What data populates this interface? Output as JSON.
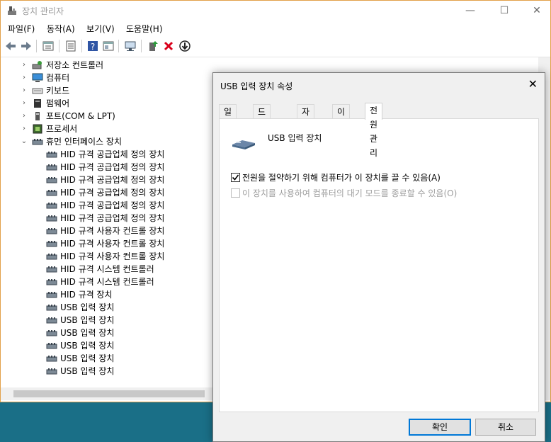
{
  "window": {
    "title": "장치 관리자",
    "minimize": "—",
    "maximize": "☐",
    "close": "✕"
  },
  "menu": [
    "파일(F)",
    "동작(A)",
    "보기(V)",
    "도움말(H)"
  ],
  "tree": {
    "categories_top": [
      {
        "label": "저장소 컨트롤러",
        "icon": "storage-controller-icon"
      },
      {
        "label": "컴퓨터",
        "icon": "computer-icon"
      },
      {
        "label": "키보드",
        "icon": "keyboard-icon"
      },
      {
        "label": "펌웨어",
        "icon": "firmware-icon"
      },
      {
        "label": "포트(COM & LPT)",
        "icon": "port-icon"
      },
      {
        "label": "프로세서",
        "icon": "processor-icon"
      }
    ],
    "expanded": {
      "label": "휴먼 인터페이스 장치",
      "icon": "hid-icon"
    },
    "children": [
      "HID 규격 공급업체 정의 장치",
      "HID 규격 공급업체 정의 장치",
      "HID 규격 공급업체 정의 장치",
      "HID 규격 공급업체 정의 장치",
      "HID 규격 공급업체 정의 장치",
      "HID 규격 공급업체 정의 장치",
      "HID 규격 사용자 컨트롤 장치",
      "HID 규격 사용자 컨트롤 장치",
      "HID 규격 사용자 컨트롤 장치",
      "HID 규격 시스템 컨트롤러",
      "HID 규격 시스템 컨트롤러",
      "HID 규격 장치",
      "USB 입력 장치",
      "USB 입력 장치",
      "USB 입력 장치",
      "USB 입력 장치",
      "USB 입력 장치",
      "USB 입력 장치"
    ]
  },
  "dialog": {
    "title": "USB 입력 장치 속성",
    "close": "✕",
    "tabs": [
      "일반",
      "드라이버",
      "자세히",
      "이벤트",
      "전원 관리"
    ],
    "active_tab": "전원 관리",
    "device_name": "USB 입력 장치",
    "options": [
      {
        "label": "전원을 절약하기 위해 컴퓨터가 이 장치를 끌 수 있음(A)",
        "checked": true,
        "enabled": true
      },
      {
        "label": "이 장치를 사용하여 컴퓨터의 대기 모드를 종료할 수 있음(O)",
        "checked": false,
        "enabled": false
      }
    ],
    "ok": "확인",
    "cancel": "취소"
  }
}
